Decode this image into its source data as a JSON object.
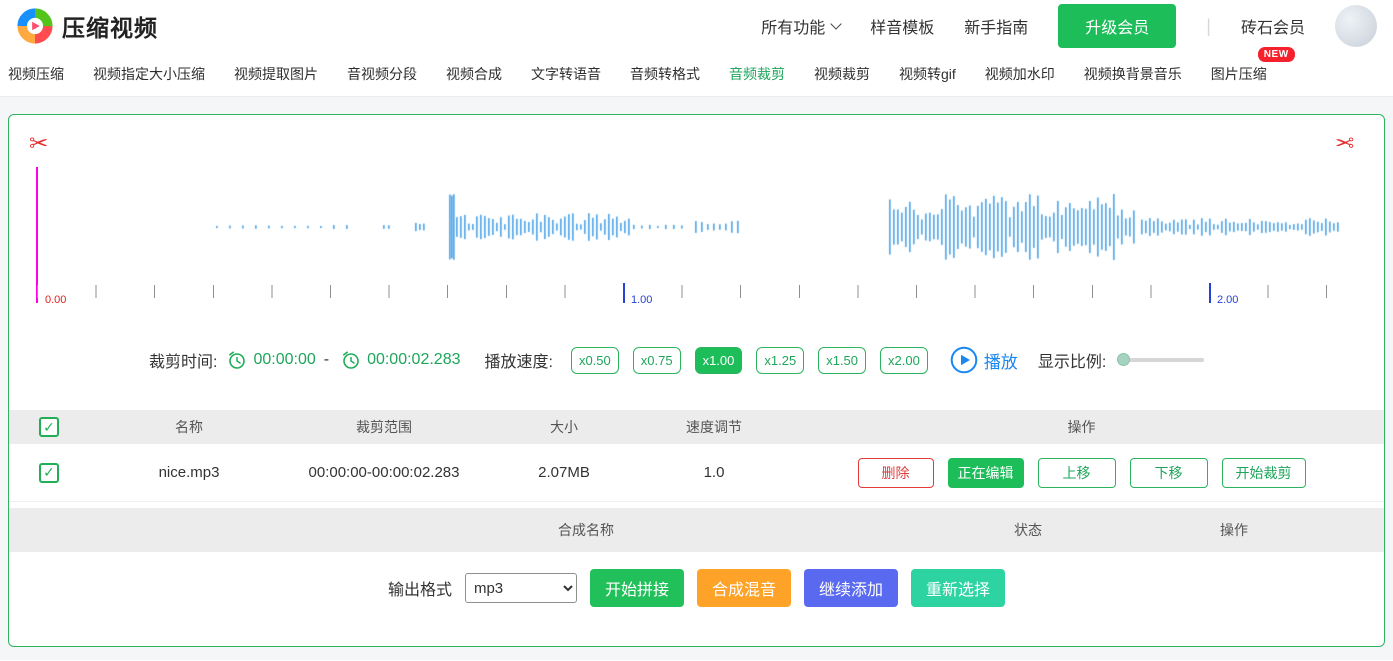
{
  "colors": {
    "green": "#1dbd5a",
    "green_text": "#1ea55b",
    "green_border": "#2cb55e",
    "blue": "#1a87f0",
    "red": "#e23c3c",
    "badge_red": "#f5222d",
    "orange": "#ffa228",
    "indigo": "#5a6af0",
    "teal": "#2ed3a2",
    "waveform_blue": "#57a9e8",
    "playhead_magenta": "#ff00ea",
    "ruler_label_red": "#e02020",
    "ruler_label_blue": "#2741d6"
  },
  "icons": {
    "scissors": "✂",
    "check": "✓"
  },
  "header": {
    "logo_text": "压缩视频",
    "nav_items": [
      {
        "label": "所有功能"
      },
      {
        "label": "样音模板"
      },
      {
        "label": "新手指南"
      }
    ],
    "upgrade_button": "升级会员",
    "divider": "|",
    "membership": "砖石会员"
  },
  "tabs": {
    "items": [
      {
        "label": "视频压缩",
        "active": false
      },
      {
        "label": "视频指定大小压缩",
        "active": false
      },
      {
        "label": "视频提取图片",
        "active": false
      },
      {
        "label": "音视频分段",
        "active": false
      },
      {
        "label": "视频合成",
        "active": false
      },
      {
        "label": "文字转语音",
        "active": false
      },
      {
        "label": "音频转格式",
        "active": false
      },
      {
        "label": "音频裁剪",
        "active": true
      },
      {
        "label": "视频裁剪",
        "active": false
      },
      {
        "label": "视频转gif",
        "active": false
      },
      {
        "label": "视频加水印",
        "active": false
      },
      {
        "label": "视频换背景音乐",
        "active": false
      },
      {
        "label": "图片压缩",
        "active": false,
        "badge": "NEW"
      }
    ]
  },
  "editor": {
    "ruler": {
      "labels": [
        {
          "text": "0.00",
          "seconds": 0
        },
        {
          "text": "1.00",
          "seconds": 1
        },
        {
          "text": "2.00",
          "seconds": 2
        }
      ]
    },
    "waveform": {
      "segments": [
        {
          "from": 179,
          "to": 309,
          "min": 0.02,
          "max": 0.06,
          "step": 13
        },
        {
          "from": 346,
          "to": 352,
          "min": 0.04,
          "max": 0.07,
          "step": 5
        },
        {
          "from": 378,
          "to": 386,
          "min": 0.09,
          "max": 0.13,
          "step": 4
        },
        {
          "from": 412,
          "to": 417,
          "min": 0.93,
          "max": 1.0,
          "step": 2
        },
        {
          "from": 419,
          "to": 594,
          "min": 0.08,
          "max": 0.42,
          "step": 4
        },
        {
          "from": 596,
          "to": 648,
          "min": 0.03,
          "max": 0.07,
          "step": 8
        },
        {
          "from": 658,
          "to": 700,
          "min": 0.05,
          "max": 0.2,
          "step": 6
        },
        {
          "from": 852,
          "to": 1096,
          "min": 0.15,
          "max": 1.0,
          "step": 4
        },
        {
          "from": 1104,
          "to": 1302,
          "min": 0.06,
          "max": 0.27,
          "step": 4
        }
      ]
    },
    "crop_time_label": "裁剪时间:",
    "start_time": "00:00:00",
    "time_separator": "-",
    "end_time": "00:00:02.283",
    "speed_label": "播放速度:",
    "speeds": [
      {
        "label": "x0.50",
        "active": false
      },
      {
        "label": "x0.75",
        "active": false
      },
      {
        "label": "x1.00",
        "active": true
      },
      {
        "label": "x1.25",
        "active": false
      },
      {
        "label": "x1.50",
        "active": false
      },
      {
        "label": "x2.00",
        "active": false
      }
    ],
    "play_label": "播放",
    "ratio_label": "显示比例:"
  },
  "file_table": {
    "headers": {
      "name": "名称",
      "range": "裁剪范围",
      "size": "大小",
      "speed": "速度调节",
      "actions": "操作"
    },
    "rows": [
      {
        "checked": true,
        "name": "nice.mp3",
        "range": "00:00:00-00:00:02.283",
        "size": "2.07MB",
        "speed": "1.0",
        "actions": {
          "delete": "删除",
          "editing": "正在编辑",
          "move_up": "上移",
          "move_down": "下移",
          "start_crop": "开始裁剪"
        }
      }
    ]
  },
  "merge_table": {
    "headers": {
      "name": "合成名称",
      "status": "状态",
      "actions": "操作"
    }
  },
  "output": {
    "format_label": "输出格式",
    "format_value": "mp3",
    "buttons": {
      "splice": "开始拼接",
      "mix": "合成混音",
      "add": "继续添加",
      "reselect": "重新选择"
    }
  }
}
